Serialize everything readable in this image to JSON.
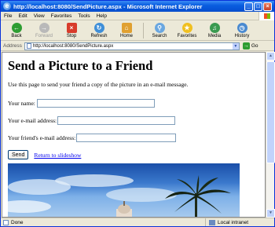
{
  "window": {
    "title": "http://localhost:8080/SendPicture.aspx - Microsoft Internet Explorer"
  },
  "menu": [
    "File",
    "Edit",
    "View",
    "Favorites",
    "Tools",
    "Help"
  ],
  "toolbar": {
    "back": "Back",
    "forward": "Forward",
    "stop": "Stop",
    "refresh": "Refresh",
    "home": "Home",
    "search": "Search",
    "favorites": "Favorites",
    "media": "Media",
    "history": "History"
  },
  "address": {
    "label": "Address",
    "url": "http://localhost:8080/SendPicture.aspx",
    "go": "Go"
  },
  "page": {
    "heading": "Send a Picture to a Friend",
    "intro": "Use this page to send your friend a copy of the picture in an e-mail message.",
    "your_name_label": "Your name:",
    "your_email_label": "Your e-mail address:",
    "friend_email_label": "Your friend's e-mail address:",
    "send_button": "Send",
    "return_link": "Return to slideshow"
  },
  "status": {
    "text": "Done",
    "zone": "Local intranet"
  },
  "colors": {
    "titlebar": "#0a5ee0",
    "link": "#0000ee"
  }
}
